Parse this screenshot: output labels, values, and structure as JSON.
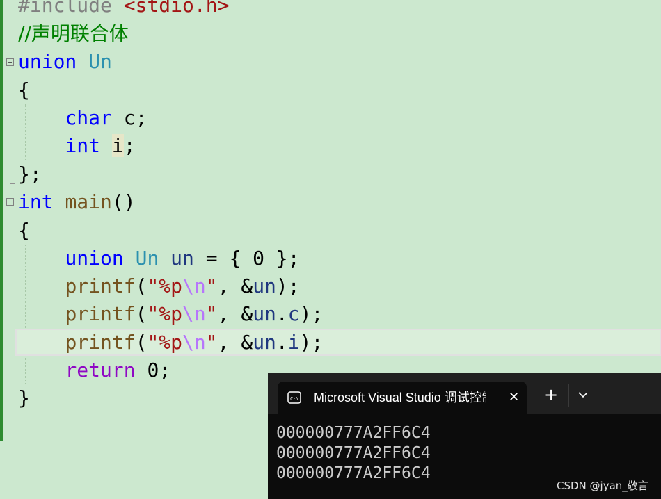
{
  "editor": {
    "line1": {
      "directive": "#include",
      "header": "<stdio.h>"
    },
    "line2": {
      "comment": "//声明联合体"
    },
    "line3": {
      "kw": "union",
      "name": "Un"
    },
    "line4": {
      "brace": "{"
    },
    "line5": {
      "type": "char",
      "rest": " c;"
    },
    "line6": {
      "type": "int",
      "var": "i",
      "semi": ";"
    },
    "line7": {
      "close": "};"
    },
    "line8": {
      "type": "int",
      "fn": "main",
      "parens": "()"
    },
    "line9": {
      "brace": "{"
    },
    "line10": {
      "kw": "union",
      "ty": "Un",
      "var": "un",
      "rest": " = { 0 };"
    },
    "line11": {
      "fn": "printf",
      "p1": "(",
      "str1": "\"%p",
      "esc": "\\n",
      "str2": "\"",
      "p2": ", &",
      "var": "un",
      "end": ");"
    },
    "line12": {
      "fn": "printf",
      "p1": "(",
      "str1": "\"%p",
      "esc": "\\n",
      "str2": "\"",
      "p2": ", &",
      "var": "un",
      "dot": ".",
      "member": "c",
      "end": ");"
    },
    "line13": {
      "fn": "printf",
      "p1": "(",
      "str1": "\"%p",
      "esc": "\\n",
      "str2": "\"",
      "p2": ", &",
      "var": "un",
      "dot": ".",
      "member": "i",
      "end": ");"
    },
    "line14": {
      "kw": "return",
      "rest": " 0;"
    },
    "line15": {
      "brace": "}"
    }
  },
  "console": {
    "tab_title": "Microsoft Visual Studio 调试控制台",
    "close_glyph": "✕",
    "plus_glyph": "+",
    "icon": "terminal-icon",
    "output": [
      "000000777A2FF6C4",
      "000000777A2FF6C4",
      "000000777A2FF6C4"
    ]
  },
  "watermark": "CSDN @jyan_敬言",
  "colors": {
    "editor_bg": "#cce8cf",
    "keyword": "#0000ff",
    "type": "#2b91af",
    "function": "#74531f",
    "string": "#a31515",
    "escape": "#b776fb",
    "control": "#8f08c4",
    "comment": "#008000",
    "console_bg": "#0c0c0c"
  }
}
